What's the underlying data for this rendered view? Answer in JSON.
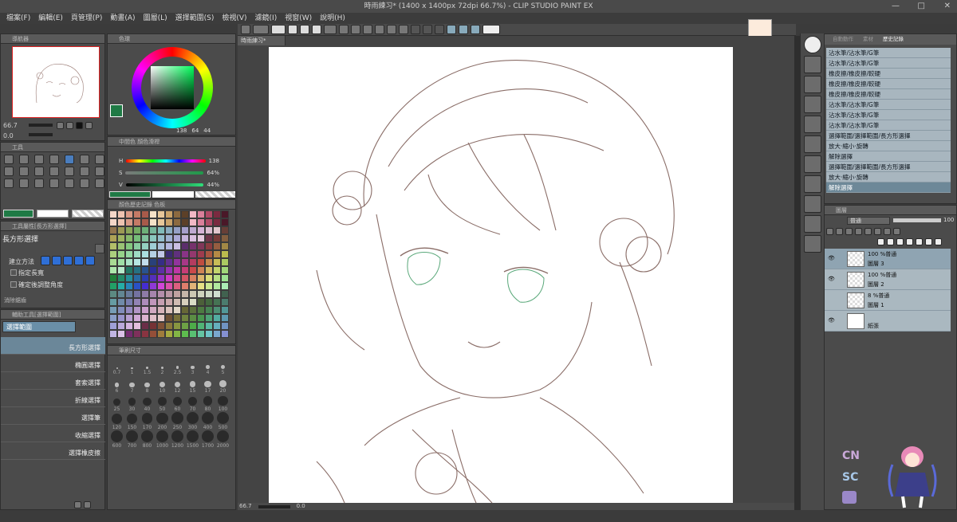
{
  "title": "時雨練习* (1400 x 1400px 72dpi 66.7%)  -  CLIP STUDIO PAINT EX",
  "window_controls": [
    "—",
    "□",
    "✕"
  ],
  "menu": [
    "檔案(F)",
    "編輯(E)",
    "頁管理(P)",
    "動畫(A)",
    "圖層(L)",
    "選擇範圍(S)",
    "檢視(V)",
    "濾鏡(I)",
    "視窗(W)",
    "說明(H)"
  ],
  "navigator": {
    "title": "導航器",
    "zoom": "66.7",
    "angle": "0.0"
  },
  "color_wheel": {
    "title": "色環",
    "h": "138",
    "s": "64",
    "v": "44",
    "main_color": "#1f7a45",
    "sub_color": "#ffffff"
  },
  "tool_panel": {
    "title": "工具"
  },
  "color_slider": {
    "title": "顏色滑桿",
    "tab2": "中間色",
    "h": "138",
    "s": "64%",
    "v": "44%",
    "h_label": "H",
    "s_label": "S",
    "v_label": "V"
  },
  "color_history": {
    "title": "顏色歷史記錄",
    "tab2": "色板"
  },
  "tool_property": {
    "title": "工具屬性[長方形選擇]",
    "tool_name": "長方形選擇",
    "create_method": "建立方法",
    "opt1": "指定長寬",
    "opt2": "確定後調整角度",
    "opt3": "消除鋸齒"
  },
  "sub_tool": {
    "title": "輔助工具[選擇範圍]",
    "group": "選擇範圍",
    "items": [
      "長方形選擇",
      "橢圓選擇",
      "套索選擇",
      "折線選擇",
      "選擇筆",
      "收縮選擇",
      "選擇橡皮擦"
    ]
  },
  "brush_size": {
    "title": "筆刷尺寸",
    "sizes": [
      "0.7",
      "1",
      "1.5",
      "2",
      "2.5",
      "3",
      "4",
      "5",
      "6",
      "7",
      "8",
      "10",
      "12",
      "15",
      "17",
      "20",
      "25",
      "30",
      "40",
      "50",
      "60",
      "70",
      "80",
      "100",
      "120",
      "150",
      "170",
      "200",
      "250",
      "300",
      "400",
      "500",
      "600",
      "700",
      "800",
      "1000",
      "1200",
      "1500",
      "1700",
      "2000"
    ]
  },
  "canvas_tab": "時雨練习*",
  "canvas_status": {
    "zoom": "66.7",
    "angle": "0.0"
  },
  "history": {
    "tabs": [
      "自動動作",
      "素材",
      "歷史記錄"
    ],
    "items": [
      "沾水筆/沾水筆/G筆",
      "沾水筆/沾水筆/G筆",
      "橡皮擦/橡皮擦/較硬",
      "橡皮擦/橡皮擦/較硬",
      "橡皮擦/橡皮擦/較硬",
      "沾水筆/沾水筆/G筆",
      "沾水筆/沾水筆/G筆",
      "沾水筆/沾水筆/G筆",
      "選擇範圍/選擇範圍/長方形選擇",
      "放大·縮小·旋轉",
      "解除選擇",
      "選擇範圍/選擇範圍/長方形選擇",
      "放大·縮小·旋轉",
      "解除選擇"
    ]
  },
  "layers": {
    "title": "圖層",
    "blend_mode": "普通",
    "opacity": "100",
    "items": [
      {
        "mode": "100 %普通",
        "name": "圖層 3"
      },
      {
        "mode": "100 %普通",
        "name": "圖層 2"
      },
      {
        "mode": "8 %普通",
        "name": "圖層 1"
      },
      {
        "mode": "",
        "name": "紙張"
      }
    ]
  },
  "watermark": {
    "cn": "CN",
    "sc": "SC"
  }
}
